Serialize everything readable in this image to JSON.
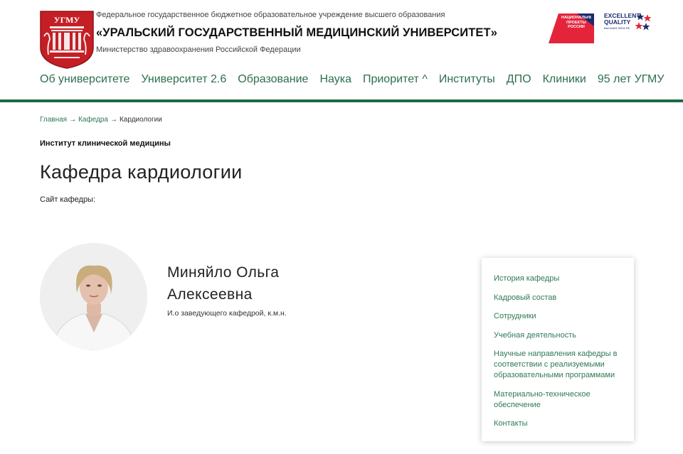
{
  "header": {
    "logo_text": "УГМУ",
    "org_top": "Федеральное государственное бюджетное образовательное учреждение высшего образования",
    "org_name": "«УРАЛЬСКИЙ ГОСУДАРСТВЕННЫЙ МЕДИЦИНСКИЙ УНИВЕРСИТЕТ»",
    "ministry": "Министерство здравоохранения Российской Федерации",
    "badge_np_text": "НАЦИОНАЛЬНЫЕ ПРОЕКТЫ РОССИИ",
    "badge_eq_line1": "EXCELLENT",
    "badge_eq_line2": "QUALITY",
    "badge_eq_line3": "ВЫСШАЯ ЛИГА.РФ"
  },
  "nav": {
    "items": [
      "Об университете",
      "Университет 2.6",
      "Образование",
      "Наука",
      "Приоритет ^",
      "Институты",
      "ДПО",
      "Клиники",
      "95 лет УГМУ"
    ]
  },
  "breadcrumb": {
    "home": "Главная",
    "section": "Кафедра",
    "current": "Кардиологии",
    "separator": "→"
  },
  "institute": "Институт клинической медицины",
  "page_title": "Кафедра кардиологии",
  "site_label": "Сайт кафедры:",
  "person": {
    "name": "Миняйло Ольга Алексеевна",
    "role": "И.о заведующего кафедрой, к.м.н."
  },
  "side_menu": {
    "items": [
      "История кафедры",
      "Кадровый состав",
      "Сотрудники",
      "Учебная деятельность",
      "Научные направления кафедры в соответствии с реализуемыми образовательными программами",
      "Материально-техническое обеспечение",
      "Контакты"
    ]
  },
  "colors": {
    "accent_green": "#1e6a43",
    "link_green": "#2e7a55",
    "crest_red": "#c41f25",
    "badge_red": "#e3243b",
    "badge_navy": "#1d2b6b"
  }
}
